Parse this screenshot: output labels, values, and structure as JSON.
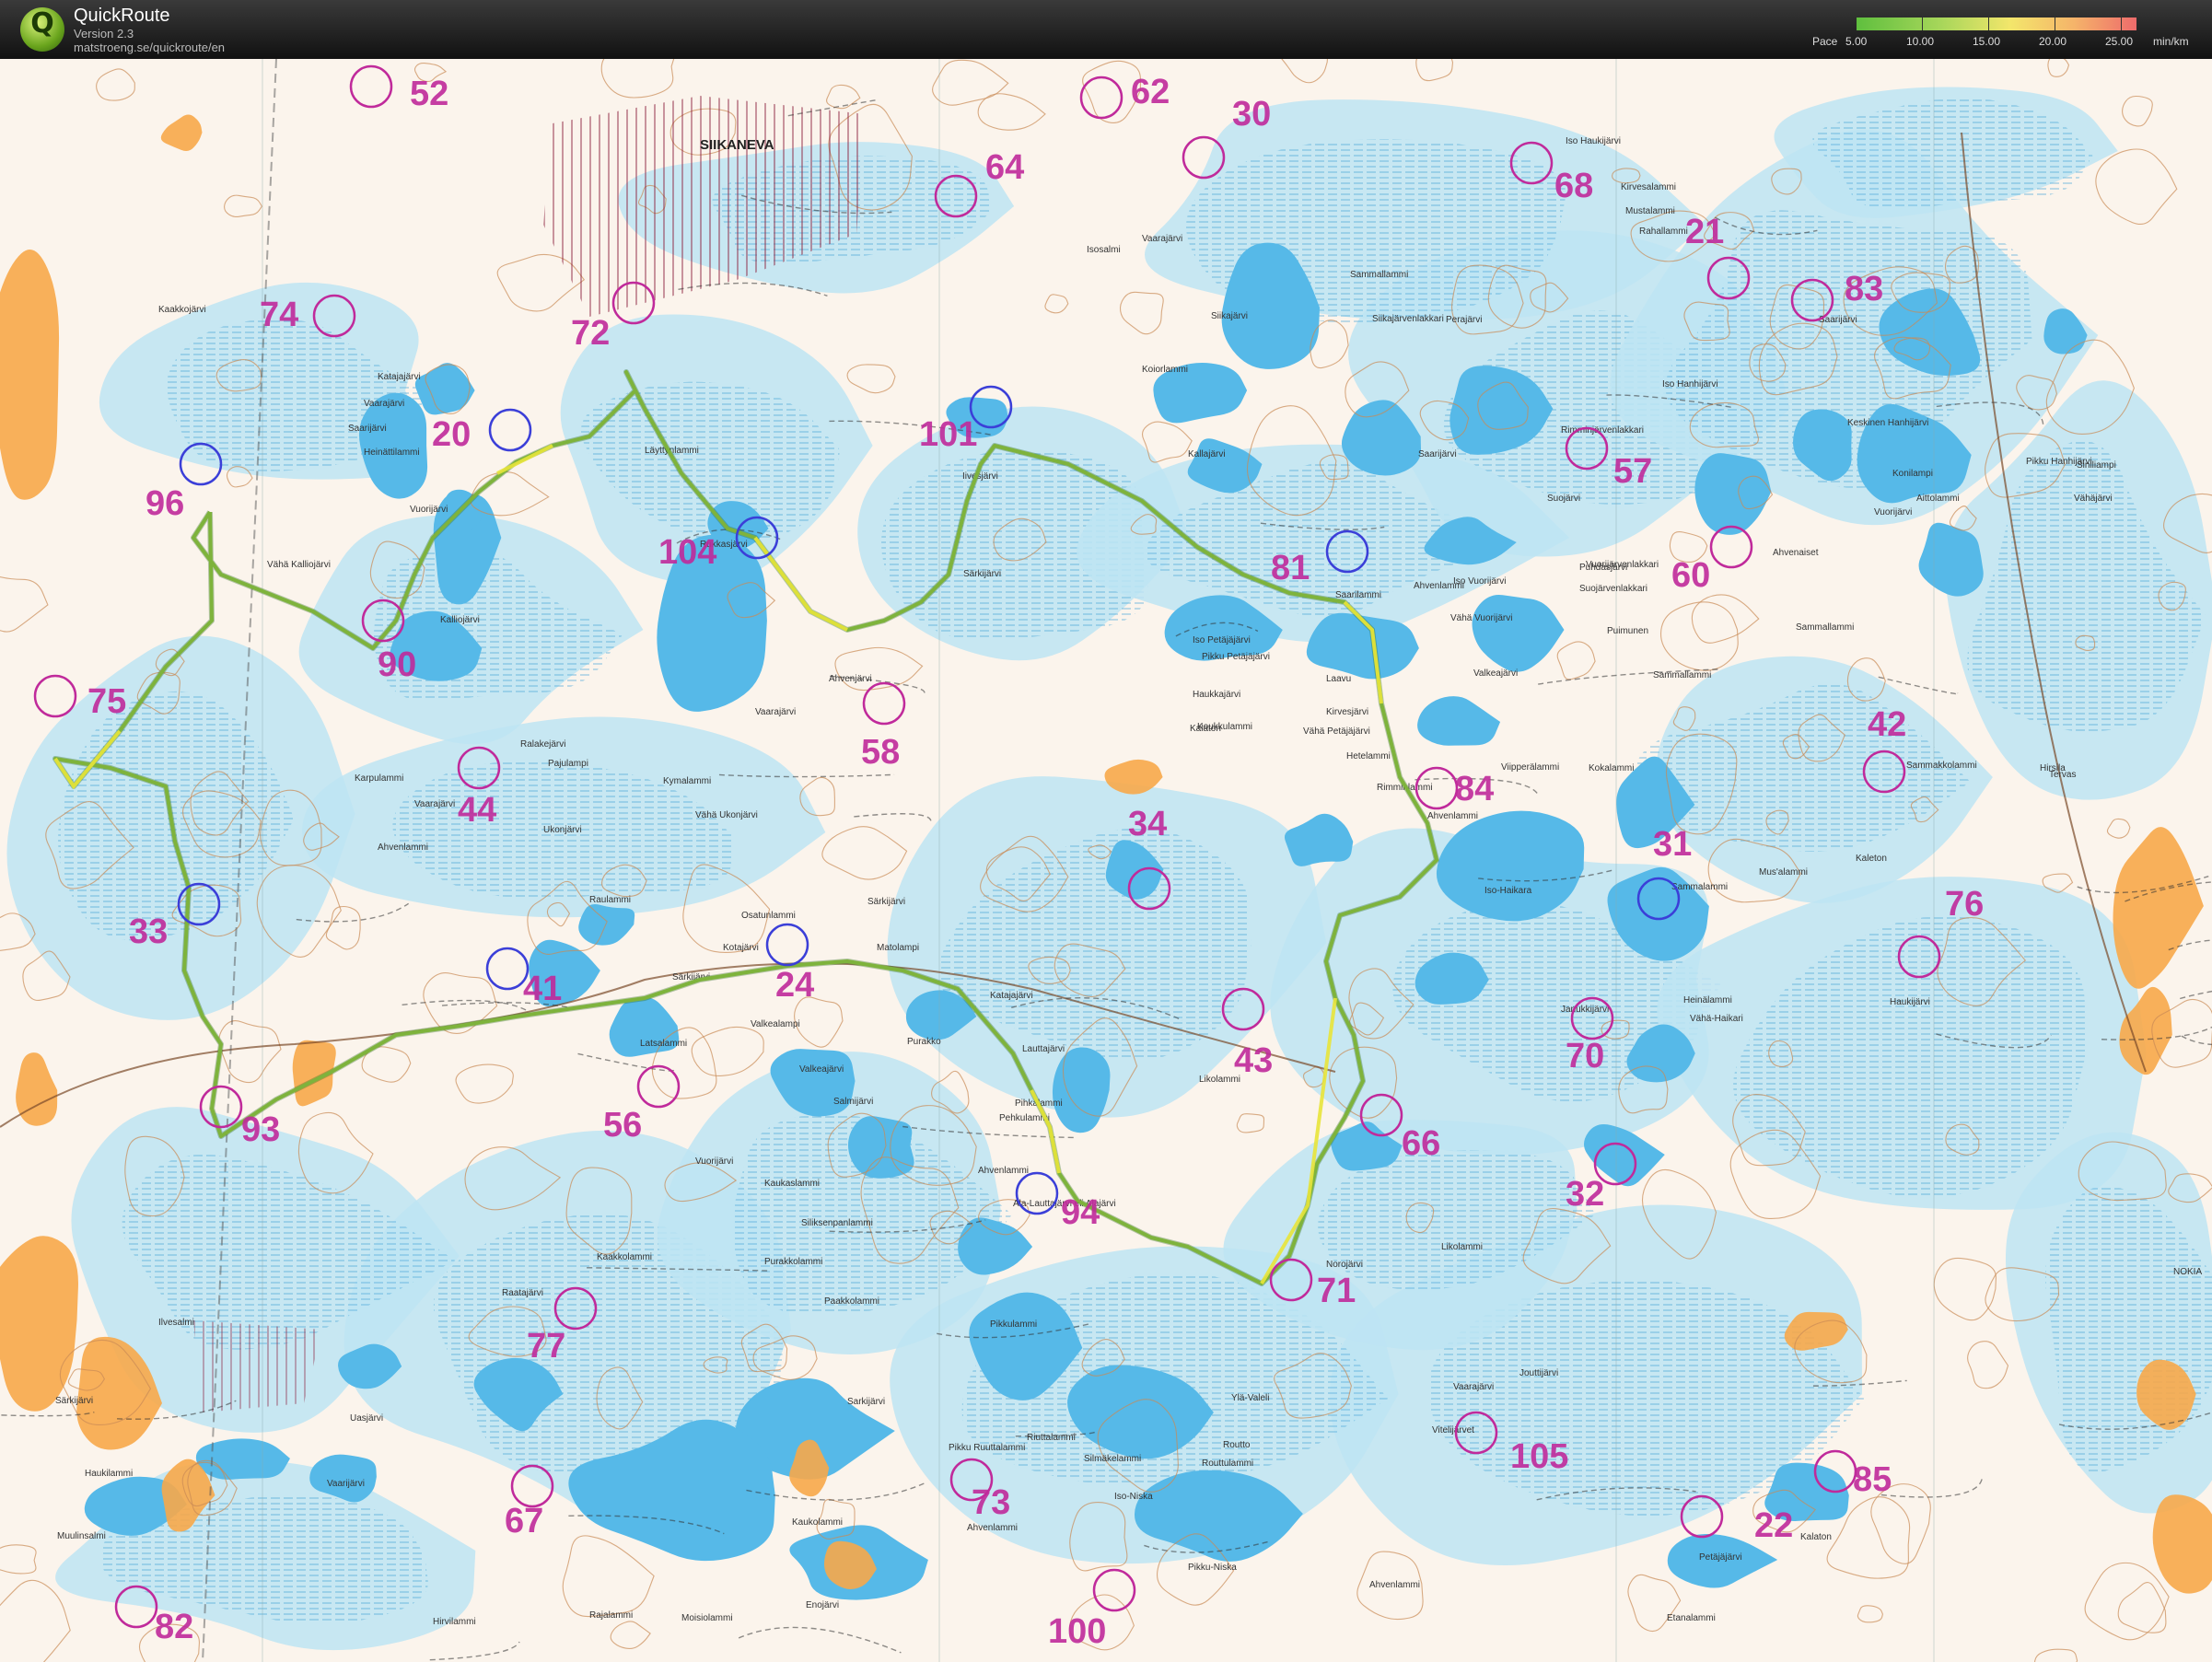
{
  "app": {
    "logo_letter": "Q",
    "name": "QuickRoute",
    "version": "Version 2.3",
    "url": "matstroeng.se/quickroute/en"
  },
  "legend": {
    "caption": "Pace",
    "values": [
      "5.00",
      "10.00",
      "15.00",
      "20.00",
      "25.00"
    ],
    "unit": "min/km",
    "gradient": [
      "#5fbf3e",
      "#a7d65a",
      "#f3e66b",
      "#f5b36a",
      "#ee6b6b"
    ]
  },
  "colors": {
    "terrain": "#fbf4ec",
    "water": "#56b9e8",
    "marsh": "#bde4f3",
    "field": "#f7a94a",
    "contour": "#c98a55",
    "track": "#7eb33c",
    "track_slow": "#e8e43a",
    "control": "#c02a9b",
    "route_controls": "#3b3fd8",
    "label_ink": "#333333"
  },
  "controls": [
    {
      "code": "52"
    },
    {
      "code": "62"
    },
    {
      "code": "30"
    },
    {
      "code": "64"
    },
    {
      "code": "68"
    },
    {
      "code": "21"
    },
    {
      "code": "83"
    },
    {
      "code": "74"
    },
    {
      "code": "72"
    },
    {
      "code": "20"
    },
    {
      "code": "101"
    },
    {
      "code": "57"
    },
    {
      "code": "96"
    },
    {
      "code": "104"
    },
    {
      "code": "81"
    },
    {
      "code": "60"
    },
    {
      "code": "90"
    },
    {
      "code": "75"
    },
    {
      "code": "58"
    },
    {
      "code": "42"
    },
    {
      "code": "44"
    },
    {
      "code": "84"
    },
    {
      "code": "34"
    },
    {
      "code": "31"
    },
    {
      "code": "76"
    },
    {
      "code": "33"
    },
    {
      "code": "41"
    },
    {
      "code": "24"
    },
    {
      "code": "43"
    },
    {
      "code": "70"
    },
    {
      "code": "93"
    },
    {
      "code": "56"
    },
    {
      "code": "66"
    },
    {
      "code": "32"
    },
    {
      "code": "94"
    },
    {
      "code": "71"
    },
    {
      "code": "77"
    },
    {
      "code": "105"
    },
    {
      "code": "85"
    },
    {
      "code": "67"
    },
    {
      "code": "73"
    },
    {
      "code": "22"
    },
    {
      "code": "82"
    },
    {
      "code": "100"
    }
  ],
  "place_names": [
    "SIIKANEVA",
    "Kaakkojärvi",
    "Katajajärvi",
    "Vaarajärvi",
    "Saarijärvi",
    "Heinättilammi",
    "Vuorijärvi",
    "Vähä Kalliojärvi",
    "Kalliojärvi",
    "Läyttynlammi",
    "Rukkasjärvi",
    "Iivesjärvi",
    "Särkijärvi",
    "Ahvenjärvi",
    "Vaarajärvi",
    "Ralakejärvi",
    "Pajulampi",
    "Karpulammi",
    "Vaarajärvi",
    "Ahvenlammi",
    "Kymalammi",
    "Vähä Ukonjärvi",
    "Ukonjärvi",
    "Raulammi",
    "Osatunlammi",
    "Särkijärvi",
    "Matolampi",
    "Kotajärvi",
    "Särkijärvi",
    "Valkealampi",
    "Latsalammi",
    "Purakko",
    "Vuorijärvi",
    "Valkeajärvi",
    "Salmijärvi",
    "Kaukaslammi",
    "Siliksenpanlammi",
    "Purakkolammi",
    "Paakkolammi",
    "Kaakkolammi",
    "Raatajärvi",
    "Ilvesalmi",
    "Särkijärvi",
    "Uasjärvi",
    "Haukilammi",
    "Vaarijärvi",
    "Muulinsalmi",
    "Hirvilammi",
    "Rajalammi",
    "Moisiolammi",
    "Enojärvi",
    "Sarkijärvi",
    "Kaukolammi",
    "Pikku Ruuttalammi",
    "Riuttalammi",
    "Silmäkelammi",
    "Iso-Niska",
    "Pikku-Niska",
    "Ahvenlammi",
    "Ylä-Valeli",
    "Routto",
    "Routtulammi",
    "Ahvenlammi",
    "Vaarajärvi",
    "Vitelijärvet",
    "Petäjäjärvi",
    "Etanalammi",
    "Kalaton",
    "Pihkalammi",
    "Ala-Lauttajärvi eli Alajärvi",
    "Pikkulammi",
    "Katajajärvi",
    "Lauttajärvi",
    "Pehkulammi",
    "Ahvenlammi",
    "Norojärvi",
    "Likolammi",
    "Likolammi",
    "Heinälammi",
    "Vähä-Haikari",
    "Janukkijärvi",
    "Iso-Haikara",
    "Sammalammi",
    "Mus'alammi",
    "Kaleton",
    "Haukijärvi",
    "Rimminlammi",
    "Ahvenlammi",
    "Hetelammi",
    "Viipperälammi",
    "Kokalammi",
    "Sammakkolammi",
    "Tervas",
    "Sammallammi",
    "Valkeajärvi",
    "Haukkajärvi",
    "Koukkulammi",
    "Kalaton",
    "Vähä Petäjäjärvi",
    "Kirvesjärvi",
    "Iso Petäjäjärvi",
    "Pikku Petäjäjärvi",
    "Laavu",
    "Saarilammi",
    "Ahvenlammi",
    "Iso Vuorijärvi",
    "Vähä Vuorijärvi",
    "Puhdasjärvi",
    "Suojärvenlakkari",
    "Vuorijärvenlakkari",
    "Kallajärvi",
    "Saarijärvi",
    "Suojärvi",
    "Rimminjärvenlakkari",
    "Siikajärvi",
    "Siikajärvenlakkari",
    "Perajärvi",
    "Sammallammi",
    "Koiorlammi",
    "Isosalmi",
    "Vaarajärvi",
    "Jouttijärvi",
    "Iso Haukijärvi",
    "Kirvesalammi",
    "Mustalammi",
    "Rahallammi",
    "Saarijärvi",
    "Iso Hanhijärvi",
    "Keskinen Hanhijärvi",
    "Konilampi",
    "Pikku Hanhijärvi",
    "Siniliampi",
    "Aittolammi",
    "Vuorijärvi",
    "Vähäjärvi",
    "Ahvenaiset",
    "Sammallammi",
    "Puimunen",
    "Hirsila",
    "NOKIA"
  ]
}
